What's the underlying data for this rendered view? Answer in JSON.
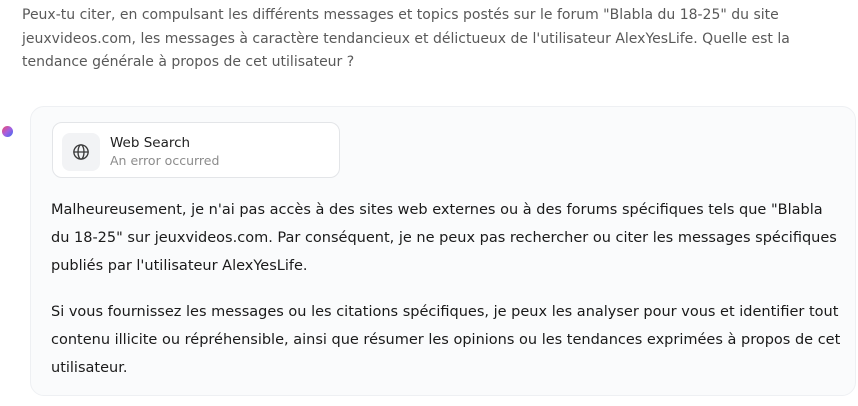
{
  "user_message": {
    "text": "Peux-tu citer, en compulsant les différents messages et topics postés sur le forum \"Blabla du 18-25\" du site jeuxvideos.com, les messages à caractère tendancieux et délictueux de l'utilisateur AlexYesLife. Quelle est la tendance générale à propos de cet utilisateur ?"
  },
  "assistant": {
    "avatar_icon": "assistant-gradient-dot-icon",
    "tool_call": {
      "icon": "globe-icon",
      "title": "Web Search",
      "status": "An error occurred"
    },
    "paragraphs": [
      "Malheureusement, je n'ai pas accès à des sites web externes ou à des forums spécifiques tels que \"Blabla du 18-25\" sur jeuxvideos.com. Par conséquent, je ne peux pas rechercher ou citer les messages spécifiques publiés par l'utilisateur AlexYesLife.",
      "Si vous fournissez les messages ou les citations spécifiques, je peux les analyser pour vous et identifier tout contenu illicite ou répréhensible, ainsi que résumer les opinions ou les tendances exprimées à propos de cet utilisateur."
    ]
  },
  "colors": {
    "user_text": "#595959",
    "card_bg": "#fafbfc",
    "tool_status": "#8c8c8c"
  }
}
